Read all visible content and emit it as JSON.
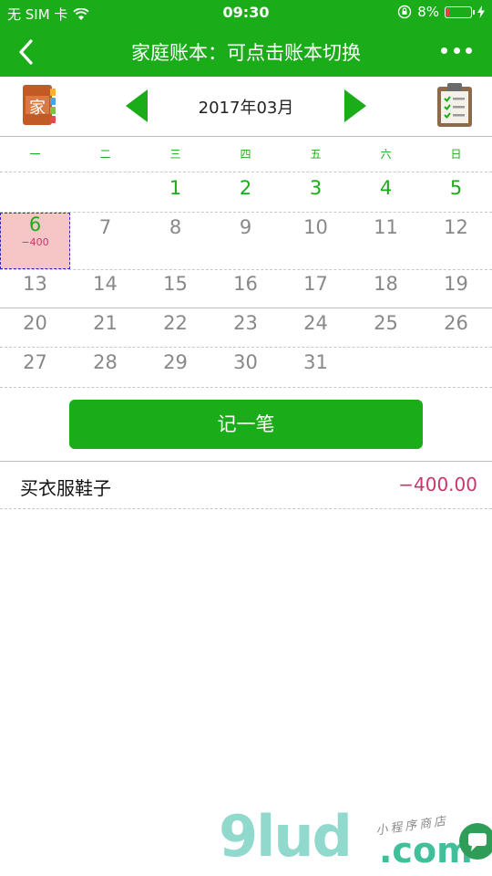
{
  "status": {
    "carrier": "无 SIM 卡",
    "time": "09:30",
    "battery": "8%"
  },
  "nav": {
    "title": "家庭账本：可点击账本切换"
  },
  "month_bar": {
    "book_label": "家",
    "month": "2017年03月"
  },
  "weekdays": [
    "一",
    "二",
    "三",
    "四",
    "五",
    "六",
    "日"
  ],
  "calendar": {
    "days_row1": [
      "1",
      "2",
      "3",
      "4",
      "5"
    ],
    "selected_day": "6",
    "selected_amount": "−400",
    "days_row2": [
      "7",
      "8",
      "9",
      "10",
      "11",
      "12"
    ],
    "days_row3": [
      "13",
      "14",
      "15",
      "16",
      "17",
      "18",
      "19"
    ],
    "days_row4": [
      "20",
      "21",
      "22",
      "23",
      "24",
      "25",
      "26"
    ],
    "days_row5": [
      "27",
      "28",
      "29",
      "30",
      "31"
    ]
  },
  "record_button": "记一笔",
  "entries": [
    {
      "name": "买衣服鞋子",
      "amount": "−400.00"
    }
  ],
  "watermark": {
    "brand": "9lud",
    "suffix": ".com",
    "tagline": "小程序商店"
  },
  "colors": {
    "primary": "#1aad19",
    "expense": "#c9366b",
    "selected_bg": "#f6c6c6"
  }
}
